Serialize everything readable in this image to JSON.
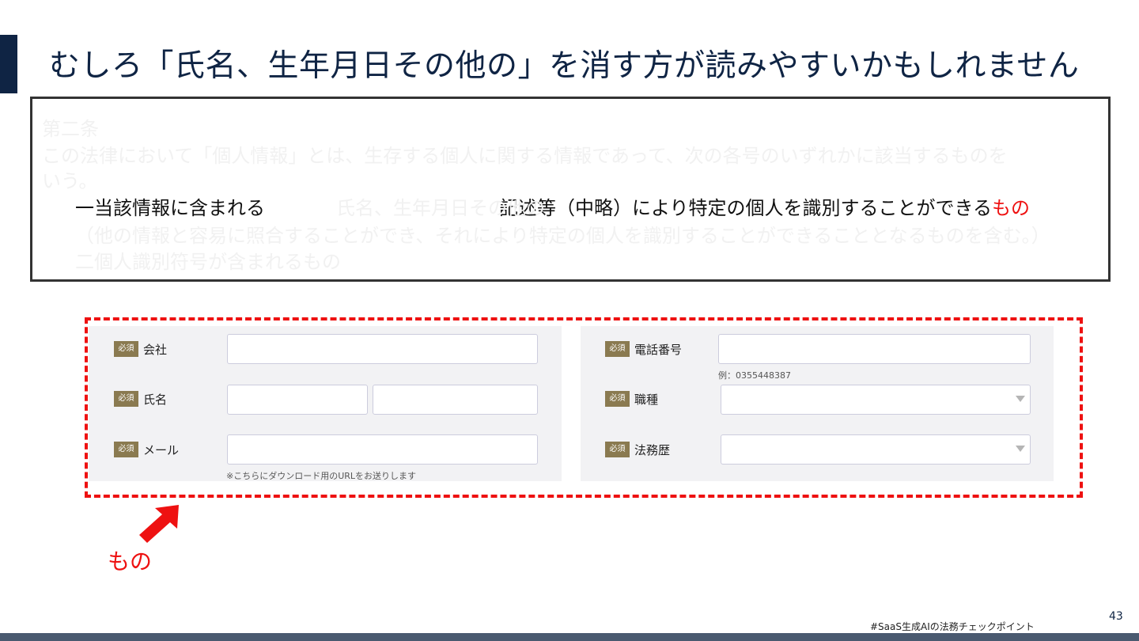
{
  "slide": {
    "title": "むしろ「氏名、生年月日その他の」を消す方が読みやすいかもしれません",
    "page_number": "43",
    "footer_tag": "#SaaS生成AIの法務チェックポイント",
    "colors": {
      "navy": "#0f2444",
      "red": "#ee1111",
      "badge": "#8a7a50"
    }
  },
  "law": {
    "heading": "第二条",
    "para_line1": "この法律において「個人情報」とは、生存する個人に関する情報であって、次の各号のいずれかに該当するものを",
    "para_line2": "いう。",
    "item1_prefix": "一当該情報に含まれる",
    "item1_deleted": "氏名、生年月日その他の",
    "item1_middle": "記述等（中略）により特定の個人を識別することができる",
    "item1_highlight": "もの",
    "item1_cont": "（他の情報と容易に照合することができ、それにより特定の個人を識別することができることとなるものを含む。）",
    "item2": "二個人識別符号が含まれるもの"
  },
  "form": {
    "required_badge": "必須",
    "company_label": "会社",
    "name_label": "氏名",
    "mail_label": "メール",
    "mail_hint": "※こちらにダウンロード用のURLをお送りします",
    "phone_label": "電話番号",
    "phone_hint": "例：0355448387",
    "job_label": "職種",
    "law_history_label": "法務歴"
  },
  "annotation": {
    "label": "もの"
  }
}
